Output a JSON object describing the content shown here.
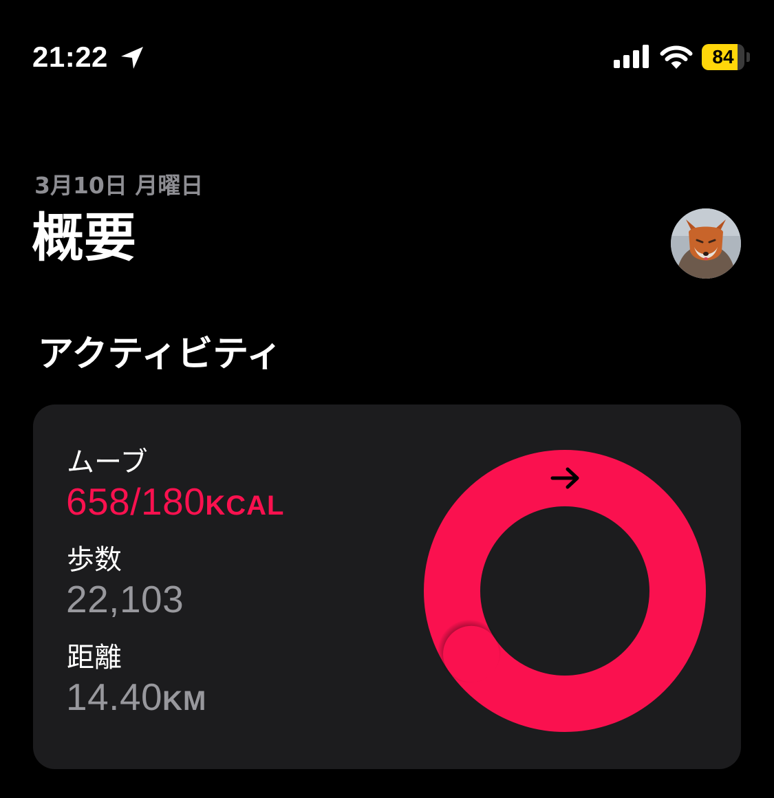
{
  "status_bar": {
    "time": "21:22",
    "battery_level": "84",
    "battery_fraction": 0.84,
    "battery_color": "#ffd60a",
    "icons": [
      "location-arrow-icon",
      "cellular-signal-icon",
      "wifi-icon",
      "battery-icon"
    ]
  },
  "header": {
    "date": "3月10日 月曜日",
    "title": "概要"
  },
  "activity": {
    "section_title": "アクティビティ",
    "move": {
      "label": "ムーブ",
      "value": "658/180",
      "unit": "KCAL",
      "current": 658,
      "goal": 180,
      "color": "#fa114f"
    },
    "steps": {
      "label": "歩数",
      "value": "22,103"
    },
    "distance": {
      "label": "距離",
      "value": "14.40",
      "unit": "KM"
    },
    "ring_icon": "arrow-right-icon"
  }
}
